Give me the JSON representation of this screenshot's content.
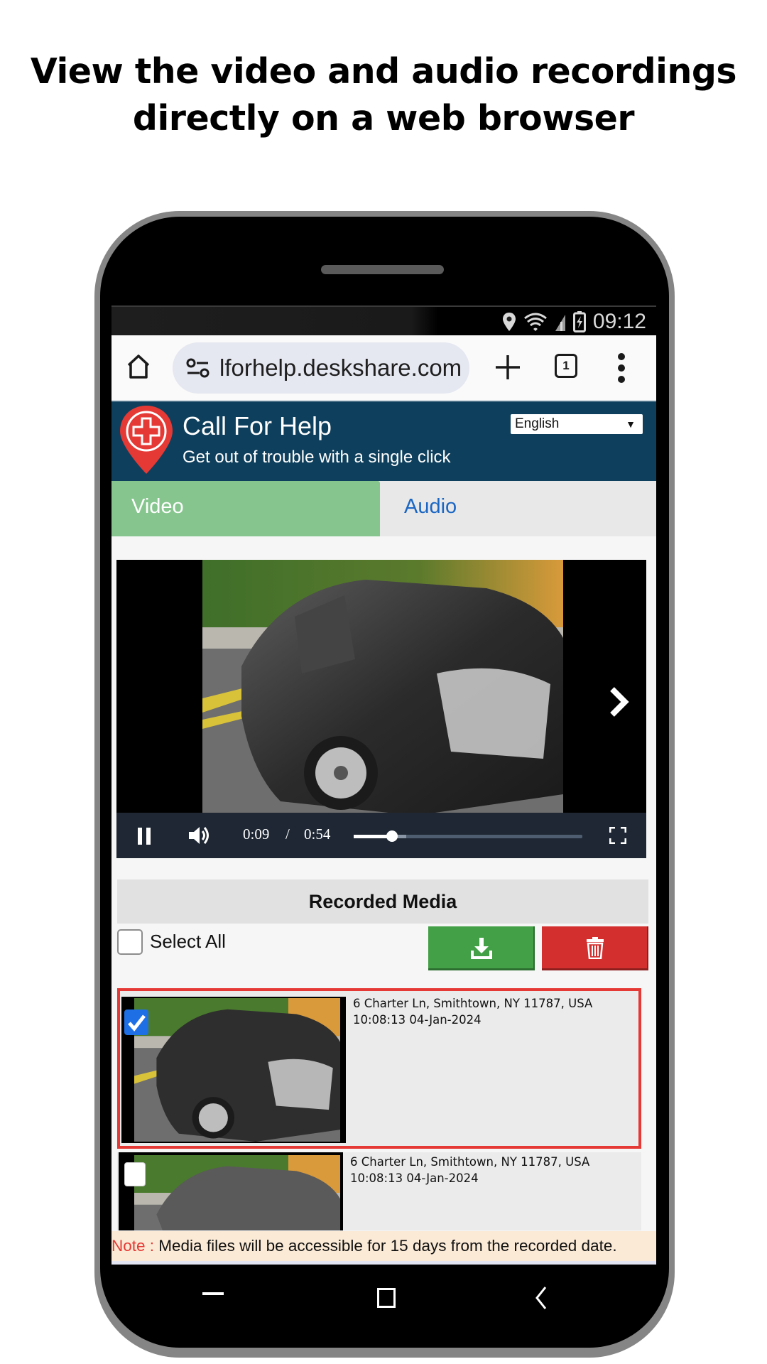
{
  "headline": {
    "line1": "View the video and audio recordings",
    "line2": "directly on a web browser"
  },
  "status_bar": {
    "icons": [
      "location-icon",
      "wifi-icon",
      "signal-icon",
      "battery-charging-icon"
    ],
    "time": "09:12"
  },
  "browser": {
    "url": "lforhelp.deskshare.com",
    "tab_count": "1",
    "icons": {
      "home": "home-icon",
      "site_settings": "tune-icon",
      "new_tab": "plus-icon",
      "tabs": "tab-switcher-icon",
      "menu": "more-vertical-icon"
    }
  },
  "app": {
    "title": "Call For Help",
    "subtitle": "Get out of trouble with a single click",
    "logo": "medical-pin-logo",
    "language": {
      "selected": "English",
      "arrow": "▼"
    },
    "brand_color": "#0e3f5c",
    "accent_red": "#e53935"
  },
  "tabs": [
    {
      "label": "Video",
      "active": true,
      "color": "#86c58e"
    },
    {
      "label": "Audio",
      "active": false,
      "color": "#1a66c4"
    }
  ],
  "player": {
    "current_time": "0:09",
    "separator": "/",
    "duration": "0:54",
    "played_fraction": 0.167,
    "buffered_fraction": 0.23,
    "icons": {
      "pause": "pause-icon",
      "volume": "volume-icon",
      "fullscreen": "fullscreen-icon",
      "next": "chevron-right-icon"
    }
  },
  "recorded_media": {
    "title": "Recorded Media",
    "select_all_label": "Select All",
    "select_all_checked": false,
    "download_button": {
      "icon": "download-icon",
      "color": "#43a047"
    },
    "delete_button": {
      "icon": "trash-icon",
      "color": "#d32f2f"
    },
    "items": [
      {
        "address": "6 Charter Ln, Smithtown, NY 11787, USA",
        "datetime": "10:08:13 04-Jan-2024",
        "checked": true,
        "selected": true
      },
      {
        "address": "6 Charter Ln, Smithtown, NY 11787, USA",
        "datetime": "10:08:13 04-Jan-2024",
        "checked": false,
        "selected": false
      }
    ]
  },
  "note": {
    "label": "Note :",
    "text": " Media files will be accessible for 15 days from the recorded date."
  },
  "nav_bar": {
    "icons": [
      "recent-apps-icon",
      "home-square-icon",
      "back-icon"
    ]
  }
}
